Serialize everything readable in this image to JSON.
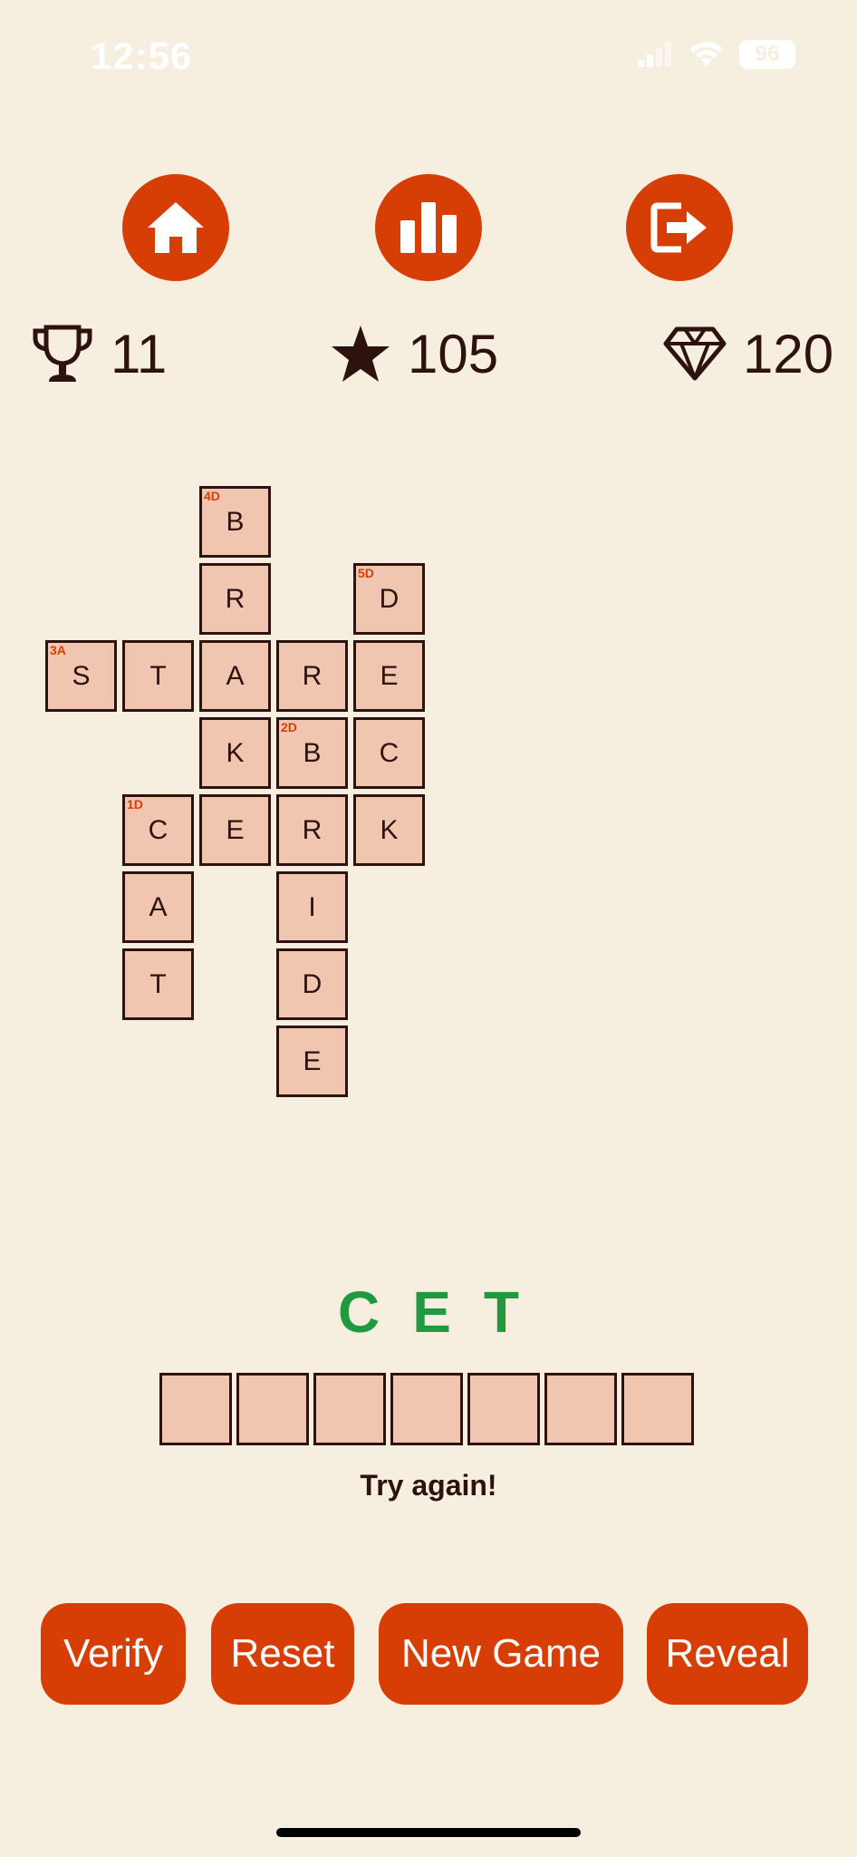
{
  "status": {
    "time": "12:56",
    "battery": "96"
  },
  "nav": {
    "home_icon": "home-icon",
    "stats_icon": "bar-chart-icon",
    "exit_icon": "logout-icon"
  },
  "stats": {
    "trophies": "11",
    "stars": "105",
    "gems": "120"
  },
  "grid": {
    "clues": {
      "c4D": "4D",
      "c5D": "5D",
      "c3A": "3A",
      "c2D": "2D",
      "c1D": "1D"
    },
    "cells": {
      "r0c2": "B",
      "r1c2": "R",
      "r1c4": "D",
      "r2c0": "S",
      "r2c1": "T",
      "r2c2": "A",
      "r2c3": "R",
      "r2c4": "E",
      "r3c2": "K",
      "r3c3": "B",
      "r3c4": "C",
      "r4c1": "C",
      "r4c2": "E",
      "r4c3": "R",
      "r4c4": "K",
      "r5c1": "A",
      "r5c3": "I",
      "r6c1": "T",
      "r6c3": "D",
      "r7c3": "E"
    }
  },
  "puzzle": {
    "letters": "CET",
    "message": "Try again!"
  },
  "actions": {
    "verify": "Verify",
    "reset": "Reset",
    "new_game": "New Game",
    "reveal": "Reveal"
  },
  "colors": {
    "background": "#f6efe0",
    "accent": "#d63e05",
    "tile": "#f1c6b0",
    "text": "#2e1210",
    "letters": "#1f9a40"
  }
}
